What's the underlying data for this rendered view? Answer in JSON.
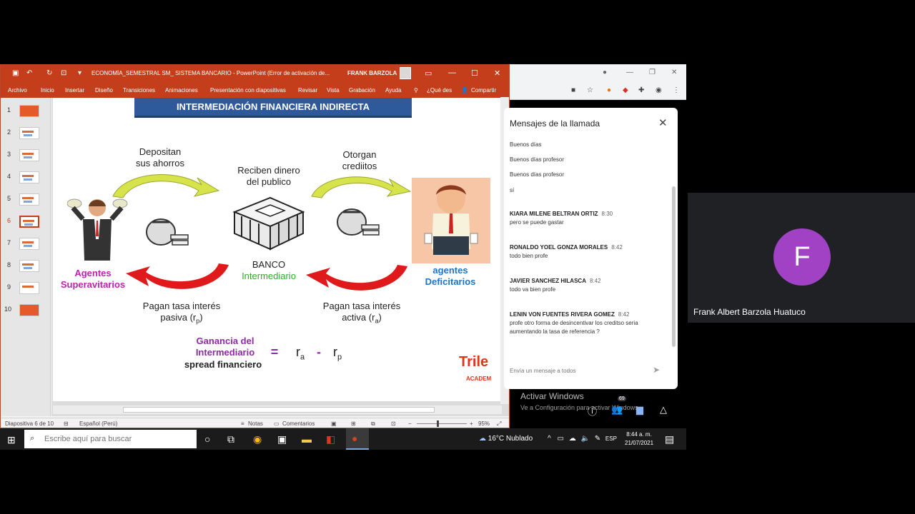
{
  "powerpoint": {
    "title": "ECONOMÍA_SEMESTRAL SM_ SISTEMA BANCARIO  -  PowerPoint (Error de activación de...",
    "user": "FRANK BARZOLA",
    "ribbon_tabs": [
      "Archivo",
      "Inicio",
      "Insertar",
      "Diseño",
      "Transiciones",
      "Animaciones",
      "Presentación con diapositivas",
      "Revisar",
      "Vista",
      "Grabación",
      "Ayuda",
      "¿Qué des",
      "Compartir"
    ],
    "thumbnails": [
      "1",
      "2",
      "3",
      "4",
      "5",
      "6",
      "7",
      "8",
      "9",
      "10"
    ],
    "selected_slide": 6,
    "status": {
      "slide_info": "Diapositiva 6 de 10",
      "language": "Español (Perú)",
      "notes": "Notas",
      "comments": "Comentarios",
      "zoom": "95%"
    }
  },
  "slide": {
    "header": "INTERMEDIACIÓN FINANCIERA INDIRECTA",
    "depositan": [
      "Depositan",
      "sus ahorros"
    ],
    "reciben": [
      "Reciben dinero",
      "del publico"
    ],
    "otorgan": [
      "Otorgan",
      "crediitos"
    ],
    "banco": "BANCO",
    "intermediario": "Intermediario",
    "agentes_sup": [
      "Agentes",
      "Superavitarios"
    ],
    "agentes_def": [
      "agentes",
      "Deficitarios"
    ],
    "pasiva": [
      "Pagan tasa interés",
      "pasiva  (r",
      "p",
      ")"
    ],
    "activa": [
      "Pagan tasa interés",
      "activa  (r",
      "a",
      ")"
    ],
    "ganancia": [
      "Ganancia del",
      "Intermediario"
    ],
    "spread": "spread  financiero",
    "formula": {
      "eq": "=",
      "ra": "r",
      "ra_sub": "a",
      "minus": "-",
      "rp": "r",
      "rp_sub": "p"
    },
    "logo": "Trile",
    "logo_sub": "ACADEM"
  },
  "chat": {
    "title": "Mensajes de la llamada",
    "messages": [
      {
        "sender": "",
        "time": "",
        "text": "Buenos días"
      },
      {
        "sender": "",
        "time": "",
        "text": "Buenos días profesor"
      },
      {
        "sender": "",
        "time": "",
        "text": "Buenos días profesor"
      },
      {
        "sender": "",
        "time": "",
        "text": "sí"
      },
      {
        "sender": "KIARA MILENE BELTRAN ORTIZ",
        "time": "8:30",
        "text": "pero se puede gastar"
      },
      {
        "sender": "RONALDO YOEL GONZA MORALES",
        "time": "8:42",
        "text": "todo bien profe"
      },
      {
        "sender": "JAVIER SANCHEZ HILASCA",
        "time": "8:42",
        "text": "todo va bien profe"
      },
      {
        "sender": "LENIN VON FUENTES RIVERA GOMEZ",
        "time": "8:42",
        "text": "profe otro forma de desincentivar los creditso seria aumentando la tasa de referencia  ?"
      }
    ],
    "input_placeholder": "Envía un mensaje a todos"
  },
  "meet": {
    "activate_title": "Activar Windows",
    "activate_sub": "Ve a Configuración para activar Windows.",
    "participant_count": "69",
    "avatar_letter": "F",
    "participant_name": "Frank Albert Barzola Huatuco"
  },
  "taskbar": {
    "search_placeholder": "Escribe aquí para buscar",
    "weather": "16°C  Nublado",
    "lang": "ESP",
    "time": "8:44 a. m.",
    "date": "21/07/2021"
  },
  "colors": {
    "ppt_accent": "#c43e1c",
    "slide_header": "#2e5a9c",
    "magenta": "#c21fb0",
    "blue": "#1f73c8",
    "green": "#2aae2a",
    "avatar": "#a142c4"
  }
}
